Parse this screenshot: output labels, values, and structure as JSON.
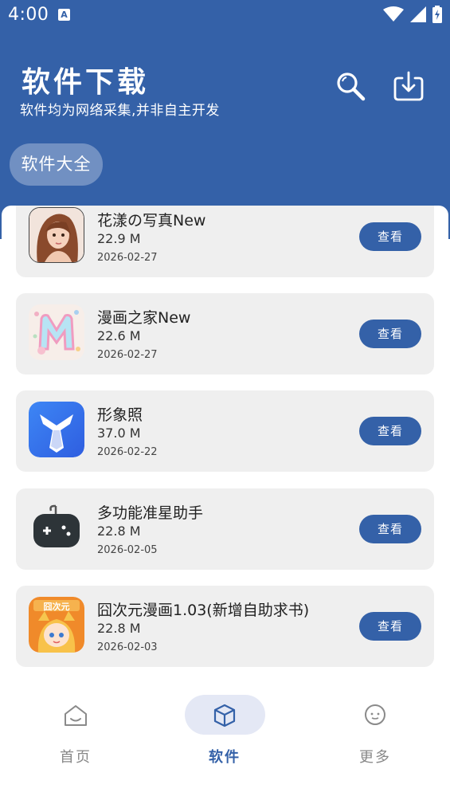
{
  "status_bar": {
    "time": "4:00",
    "notification_letter": "A"
  },
  "header": {
    "title": "软件下载",
    "subtitle": "软件均为网络采集,并非自主开发",
    "chip_label": "软件大全"
  },
  "colors": {
    "primary": "#3461a8",
    "card_bg": "#efefef",
    "pill_bg": "#e4e8f5"
  },
  "apps": [
    {
      "name": "花漾の写真New",
      "size": "22.9 M",
      "date": "2026-02-27",
      "button": "查看",
      "icon": "portrait-girl-icon"
    },
    {
      "name": "漫画之家New",
      "size": "22.6 M",
      "date": "2026-02-27",
      "button": "查看",
      "icon": "manga-m-icon"
    },
    {
      "name": "形象照",
      "size": "37.0 M",
      "date": "2026-02-22",
      "button": "查看",
      "icon": "suit-tie-icon"
    },
    {
      "name": "多功能准星助手",
      "size": "22.8 M",
      "date": "2026-02-05",
      "button": "查看",
      "icon": "gamepad-icon"
    },
    {
      "name": "囧次元漫画1.03(新增自助求书)",
      "size": "22.8 M",
      "date": "2026-02-03",
      "button": "查看",
      "icon": "anime-fox-girl-icon"
    }
  ],
  "tabs": [
    {
      "label": "首页",
      "icon": "home-icon"
    },
    {
      "label": "软件",
      "icon": "cube-icon"
    },
    {
      "label": "更多",
      "icon": "chat-bubble-icon"
    }
  ]
}
